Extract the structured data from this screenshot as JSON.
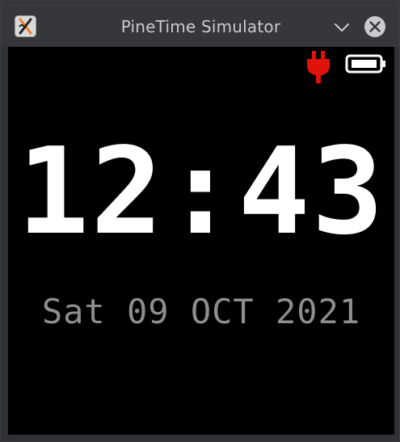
{
  "window": {
    "title": "PineTime Simulator"
  },
  "watchface": {
    "time": "12:43",
    "date": "Sat 09 OCT 2021",
    "status": {
      "power_icon": "plug-icon",
      "power_color": "#e0120c",
      "battery_icon": "battery-icon"
    }
  },
  "colors": {
    "titlebar": "#35373b",
    "screen": "#000000",
    "time": "#ffffff",
    "date": "#8e8e8e"
  }
}
